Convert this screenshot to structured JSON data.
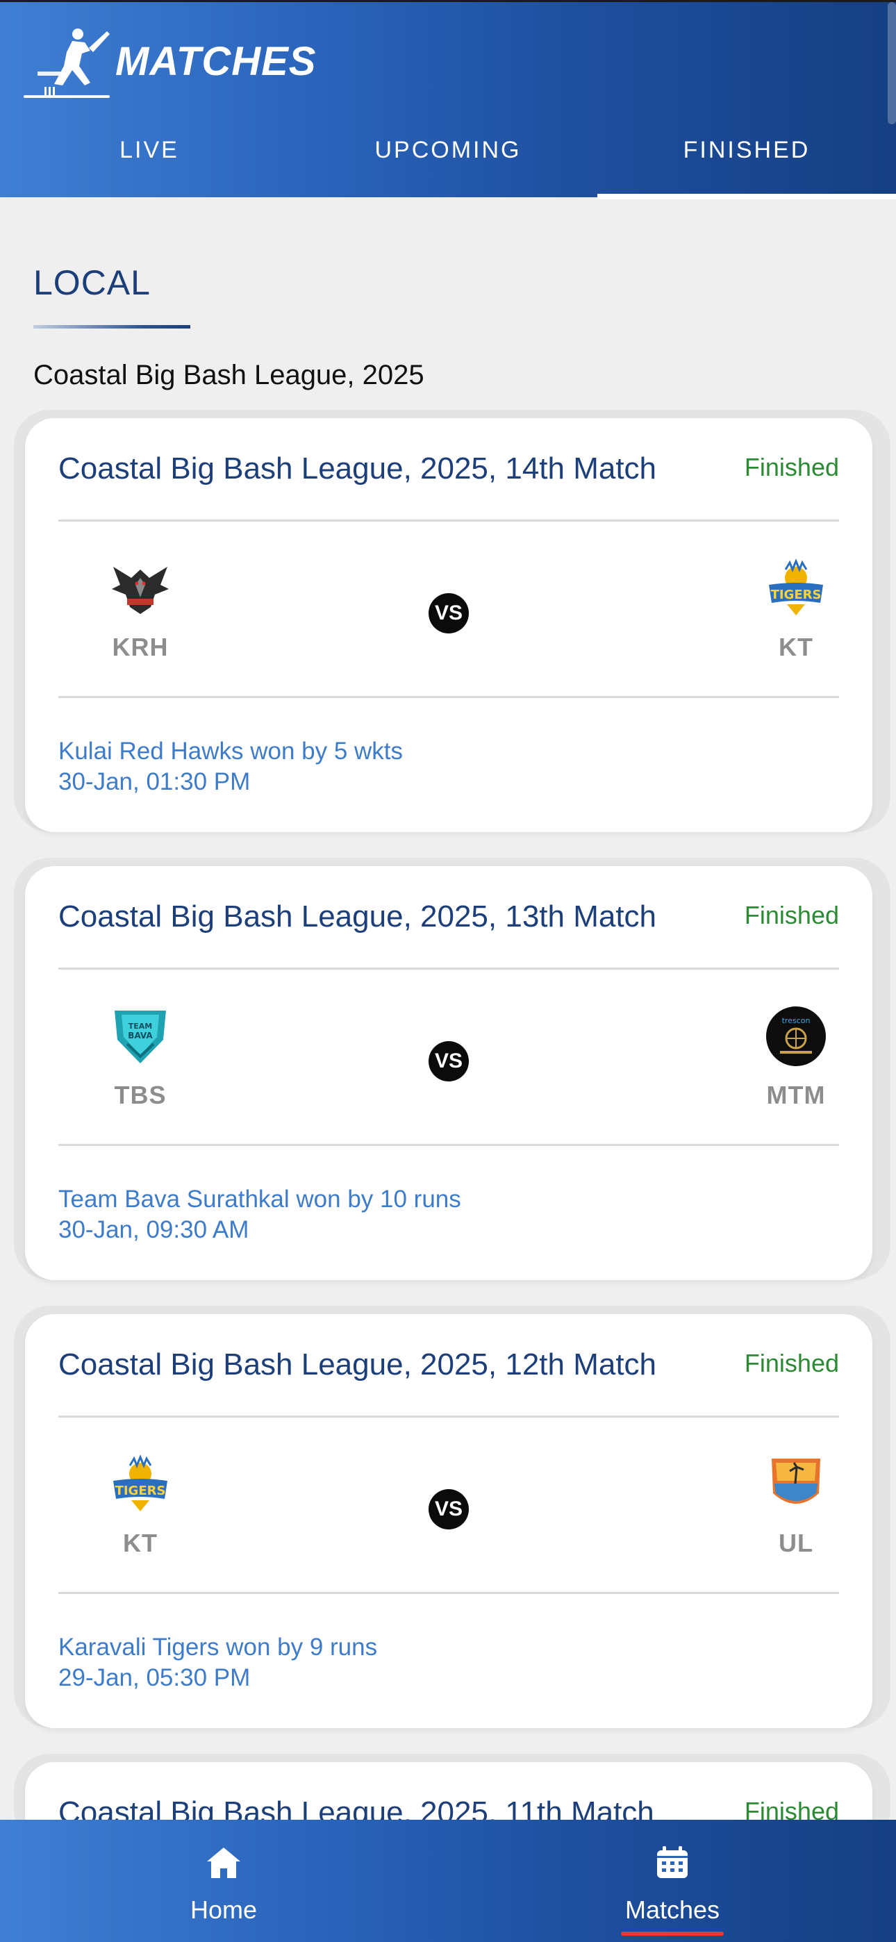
{
  "header": {
    "title": "MATCHES",
    "logo_icon": "cricket-batsman-icon",
    "tabs": [
      {
        "label": "LIVE",
        "active": false
      },
      {
        "label": "UPCOMING",
        "active": false
      },
      {
        "label": "FINISHED",
        "active": true
      }
    ]
  },
  "section": {
    "title": "LOCAL",
    "league": "Coastal Big Bash League, 2025"
  },
  "matches": [
    {
      "title": "Coastal Big Bash League, 2025, 14th Match",
      "status": "Finished",
      "team1": {
        "code": "KRH",
        "logo": "hawk-logo"
      },
      "team2": {
        "code": "KT",
        "logo": "tigers-logo"
      },
      "vs": "VS",
      "result": "Kulai Red Hawks won by 5 wkts",
      "datetime": "30-Jan, 01:30 PM"
    },
    {
      "title": "Coastal Big Bash League, 2025, 13th Match",
      "status": "Finished",
      "team1": {
        "code": "TBS",
        "logo": "team-bava-logo"
      },
      "team2": {
        "code": "MTM",
        "logo": "mtm-logo"
      },
      "vs": "VS",
      "result": "Team Bava Surathkal won by 10 runs",
      "datetime": "30-Jan, 09:30 AM"
    },
    {
      "title": "Coastal Big Bash League, 2025, 12th Match",
      "status": "Finished",
      "team1": {
        "code": "KT",
        "logo": "tigers-logo"
      },
      "team2": {
        "code": "UL",
        "logo": "ul-logo"
      },
      "vs": "VS",
      "result": "Karavali Tigers won by 9 runs",
      "datetime": "29-Jan, 05:30 PM"
    },
    {
      "title": "Coastal Big Bash League, 2025, 11th Match",
      "status": "Finished"
    }
  ],
  "bottom_nav": [
    {
      "label": "Home",
      "icon": "home-icon",
      "active": false
    },
    {
      "label": "Matches",
      "icon": "calendar-icon",
      "active": true
    }
  ],
  "colors": {
    "header_start": "#3f7fd3",
    "header_end": "#163f83",
    "title_blue": "#1c3f7a",
    "status_green": "#2d8a34",
    "result_blue": "#3e7cc9",
    "active_indicator": "#e53935"
  }
}
